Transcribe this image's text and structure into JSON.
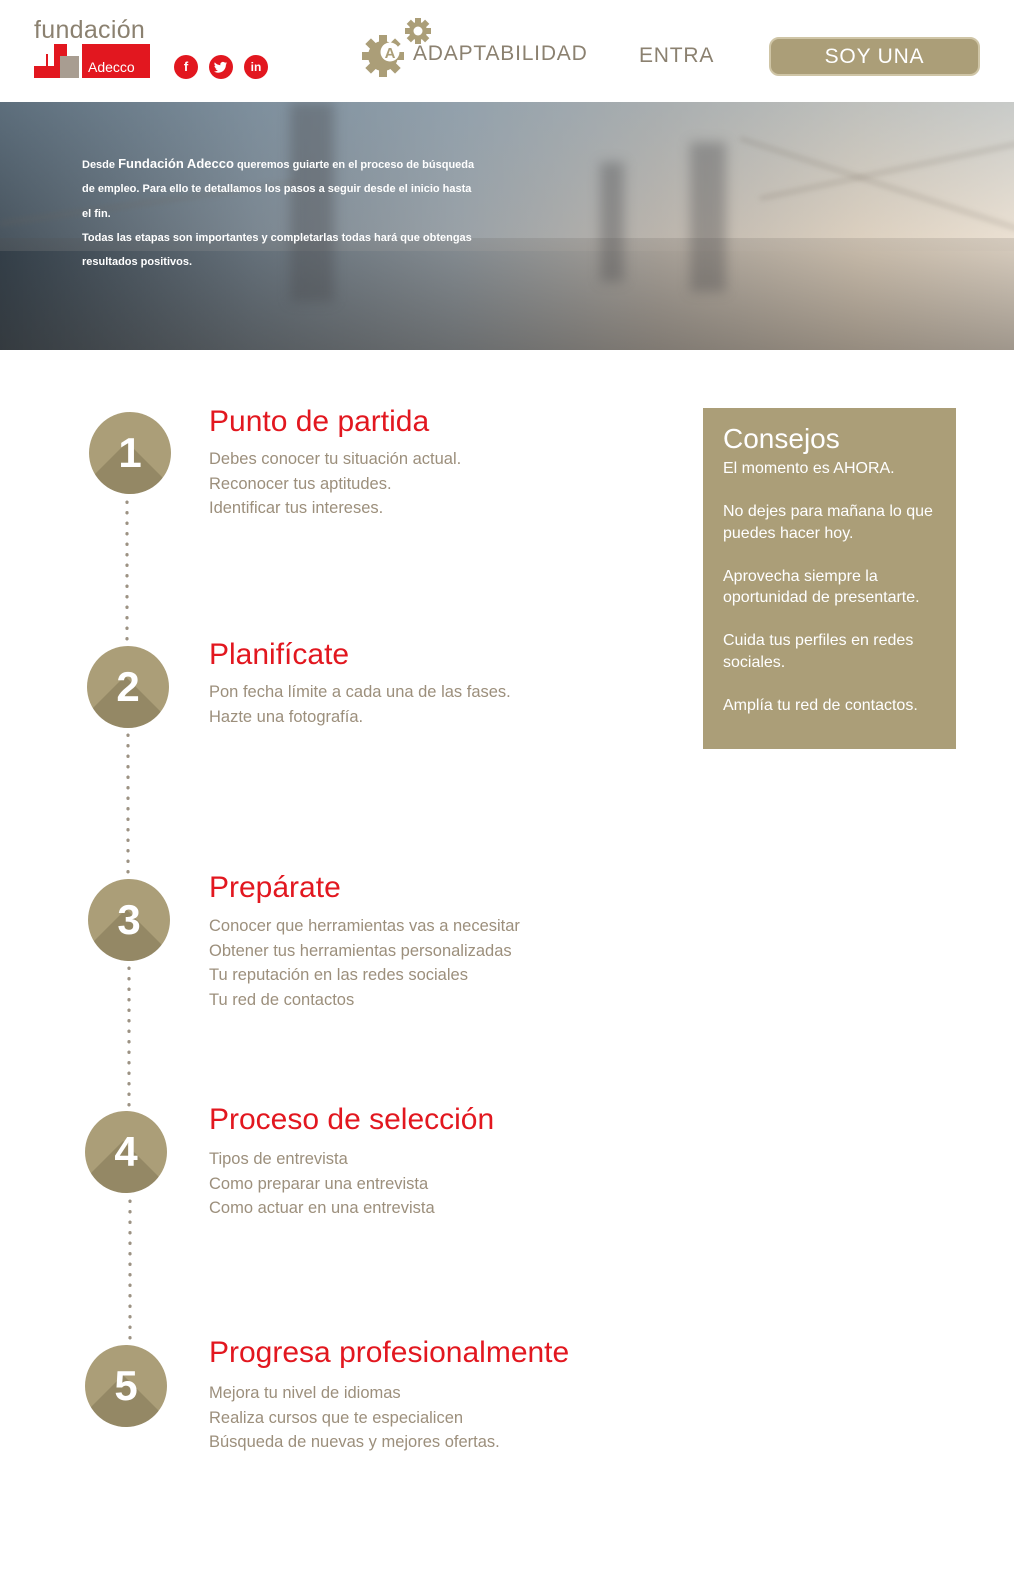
{
  "header": {
    "logo_word": "fundación",
    "logo_brand": "Adecco",
    "social": [
      {
        "icon": "facebook-icon",
        "glyph": "f"
      },
      {
        "icon": "twitter-icon",
        "glyph": "t"
      },
      {
        "icon": "linkedin-icon",
        "glyph": "in"
      }
    ],
    "nav": {
      "adaptabilidad": "ADAPTABILIDAD",
      "adapt_badge": "A",
      "entra": "ENTRA",
      "empresa": "SOY UNA EMPRESA"
    }
  },
  "hero": {
    "prefix": "Desde ",
    "brand": "Fundación Adecco",
    "line1_rest": " queremos guiarte en el proceso de búsqueda de empleo. Para ello te detallamos los pasos a seguir desde el inicio hasta el fin.",
    "line2": "Todas las etapas son importantes y completarlas todas hará que obtengas resultados positivos."
  },
  "steps": [
    {
      "number": "1",
      "title": "Punto de partida",
      "lines": [
        "Debes conocer tu situación actual.",
        "Reconocer tus aptitudes.",
        "Identificar tus intereses."
      ]
    },
    {
      "number": "2",
      "title": "Planifícate",
      "lines": [
        "Pon fecha límite a cada una de las fases.",
        "Hazte una fotografía."
      ]
    },
    {
      "number": "3",
      "title": "Prepárate",
      "lines": [
        "Conocer que herramientas vas a necesitar",
        "Obtener tus herramientas personalizadas",
        "Tu reputación en las redes sociales",
        "Tu red de contactos"
      ]
    },
    {
      "number": "4",
      "title": "Proceso de selección",
      "lines": [
        "Tipos de entrevista",
        "Como preparar una entrevista",
        "Como actuar en una entrevista"
      ]
    },
    {
      "number": "5",
      "title": "Progresa profesionalmente",
      "lines": [
        "Mejora tu nivel de idiomas",
        "Realiza cursos que te especialicen",
        "Búsqueda de nuevas y mejores ofertas."
      ]
    }
  ],
  "consejos": {
    "title": "Consejos",
    "items": [
      "El momento es AHORA.",
      "No dejes para mañana lo que puedes hacer hoy.",
      "Aprovecha siempre la oportunidad de presentarte.",
      "Cuida tus perfiles en redes sociales.",
      "Amplía tu red de contactos."
    ]
  },
  "colors": {
    "accent_red": "#e2171f",
    "gold": "#ab9e78",
    "text_taupe": "#9c8f7c",
    "nav_text": "#8b8170"
  }
}
